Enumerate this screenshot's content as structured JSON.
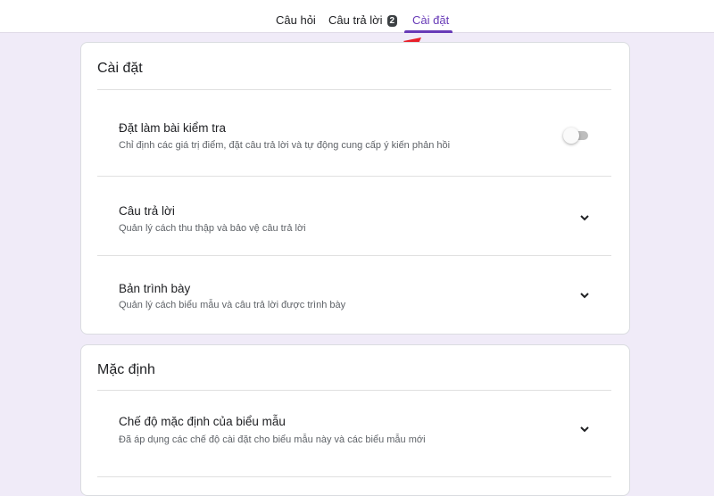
{
  "tabs": [
    {
      "label": "Câu hỏi"
    },
    {
      "label": "Câu trả lời",
      "badge": "2"
    },
    {
      "label": "Cài đặt",
      "active": true
    }
  ],
  "settings_card": {
    "title": "Cài đặt",
    "items": [
      {
        "title": "Đặt làm bài kiểm tra",
        "subtitle": "Chỉ định các giá trị điểm, đặt câu trả lời và tự động cung cấp ý kiến phản hồi",
        "control": "toggle",
        "enabled": false
      },
      {
        "title": "Câu trả lời",
        "subtitle": "Quản lý cách thu thập và bảo vệ câu trả lời",
        "control": "chevron-down"
      },
      {
        "title": "Bản trình bày",
        "subtitle": "Quản lý cách biểu mẫu và câu trả lời được trình bày",
        "control": "chevron-down"
      }
    ]
  },
  "defaults_card": {
    "title": "Mặc định",
    "items": [
      {
        "title": "Chế độ mặc định của biểu mẫu",
        "subtitle": "Đã áp dụng các chế độ cài đặt cho biểu mẫu này và các biểu mẫu mới",
        "control": "chevron-down"
      }
    ]
  },
  "colors": {
    "accent": "#673ab7",
    "background": "#f0ebf8",
    "annotation_arrow": "#e8202a"
  }
}
